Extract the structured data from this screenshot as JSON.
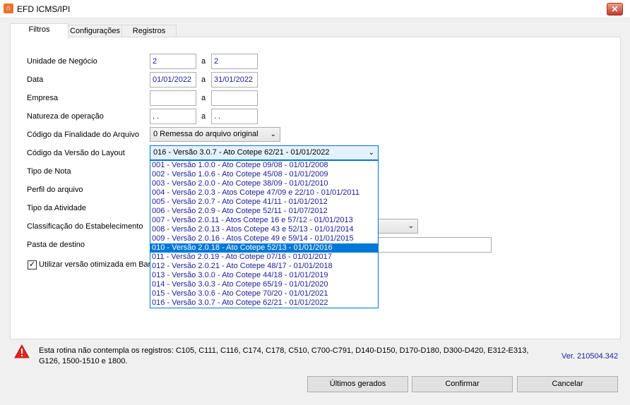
{
  "window": {
    "title": "EFD ICMS/IPI",
    "close_symbol": "✕"
  },
  "tabs": [
    {
      "label": "Filtros"
    },
    {
      "label": "Configurações"
    },
    {
      "label": "Registros"
    }
  ],
  "form": {
    "range_separator": "a",
    "unidade": {
      "label": "Unidade de Negócio",
      "from": "2",
      "to": "2"
    },
    "data": {
      "label": "Data",
      "from": "01/01/2022",
      "to": "31/01/2022"
    },
    "empresa": {
      "label": "Empresa",
      "from": "",
      "to": ""
    },
    "natureza": {
      "label": "Natureza de operação",
      "from": ". .",
      "to": ". ."
    },
    "finalidade": {
      "label": "Código da Finalidade do Arquivo",
      "value": "0 Remessa do arquivo original"
    },
    "versao": {
      "label": "Código da Versão do Layout",
      "value": "016 - Versão 3.0.7 - Ato Cotepe 62/21 - 01/01/2022"
    },
    "tipo_nota": {
      "label": "Tipo de Nota"
    },
    "perfil": {
      "label": "Perfil do arquivo"
    },
    "tipo_atividade": {
      "label": "Tipo da Atividade"
    },
    "classificacao": {
      "label": "Classificação do Estabelecimento"
    },
    "pasta": {
      "label": "Pasta de destino",
      "value": ""
    },
    "otimizada": {
      "label": "Utilizar versão otimizada em Banc",
      "checked": true
    }
  },
  "versao_options": [
    "001 - Versão 1.0.0 - Ato Cotepe 09/08 - 01/01/2008",
    "002 - Versão 1.0.6 - Ato Cotepe 45/08 - 01/01/2009",
    "003 - Versão 2.0.0 - Ato Cotepe 38/09 - 01/01/2010",
    "004 - Versão 2.0.3 - Atos Cotepe 47/09 e 22/10 - 01/01/2011",
    "005 - Versão 2.0.7 - Ato Cotepe 41/11 - 01/01/2012",
    "006 - Versão 2.0.9 - Ato Cotepe 52/11 - 01/07/2012",
    "007 - Versão 2.0.11 - Atos Cotepe 16 e 57/12 - 01/01/2013",
    "008 - Versão 2.0.13 - Atos Cotepe 43 e 52/13 - 01/01/2014",
    "009 - Versão 2.0.16 - Atos Cotepe 49 e 59/14 - 01/01/2015",
    "010 - Versão 2.0.18 - Ato Cotepe 52/13 - 01/01/2016",
    "011 - Versão 2.0.19 - Ato Cotepe 07/16 - 01/01/2017",
    "012 - Versão 2.0.21 - Ato Cotepe 48/17 - 01/01/2018",
    "013 - Versão 3.0.0 - Ato Cotepe 44/18 - 01/01/2019",
    "014 - Versão 3.0.3 - Ato Cotepe 65/19 - 01/01/2020",
    "015 - Versão 3.0.6 - Ato Cotepe 70/20 - 01/01/2021",
    "016 - Versão 3.0.7 - Ato Cotepe 62/21 - 01/01/2022"
  ],
  "versao_highlighted_index": 9,
  "warning": {
    "text": "Esta rotina não contempla os registros: C105, C111, C116, C174, C178, C510, C700-C791, D140-D150, D170-D180, D300-D420, E312-E313, G126, 1500-1510 e 1800."
  },
  "version_label": "Ver. 210504.342",
  "buttons": {
    "ultimos": "Últimos gerados",
    "confirmar": "Confirmar",
    "cancelar": "Cancelar"
  },
  "colors": {
    "accent": "#0078d7",
    "value_text": "#1c1c9c",
    "warning": "#e0261e"
  }
}
